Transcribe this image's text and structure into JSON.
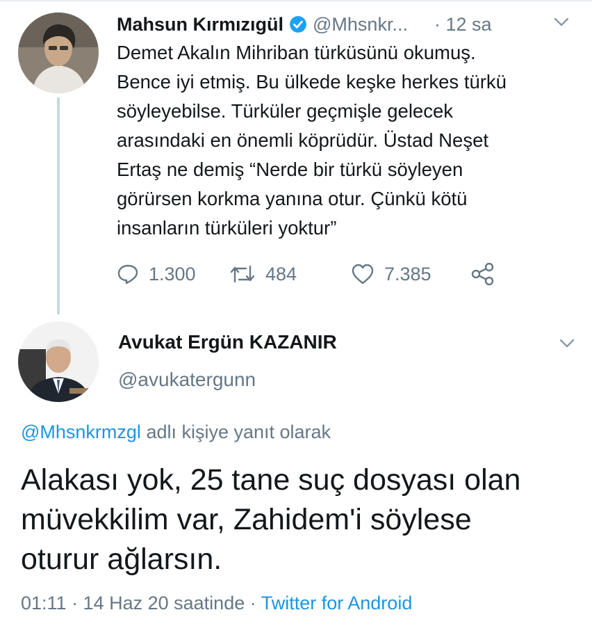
{
  "colors": {
    "text_primary": "#14171a",
    "text_secondary": "#657786",
    "link": "#1b95e0",
    "verified": "#1da1f2",
    "thread_line": "#ccd6dd"
  },
  "tweet": {
    "author_name": "Mahsun Kırmızıgül",
    "verified_icon": "verified-badge-icon",
    "handle": "@Mhsnkr...",
    "time": "· 12 sa",
    "text_lines": [
      "Demet Akalın Mihriban türküsünü okumuş.",
      "Bence iyi etmiş. Bu ülkede keşke herkes türkü",
      "söyleyebilse.  Türküler geçmişle gelecek",
      "arasındaki en önemli köprüdür. Üstad Neşet",
      "Ertaş ne demiş  “Nerde bir türkü söyleyen",
      "görürsen korkma yanına otur. Çünkü kötü",
      "insanların türküleri yoktur”"
    ],
    "replies": "1.300",
    "retweets": "484",
    "likes": "7.385",
    "icons": [
      "reply-icon",
      "retweet-icon",
      "like-icon",
      "share-icon"
    ]
  },
  "reply": {
    "author_name": "Avukat Ergün KAZANIR",
    "handle": "@avukatergunn",
    "reply_mention": "@Mhsnkrmzgl",
    "reply_context_suffix": " adlı kişiye yanıt olarak",
    "text_lines": [
      "Alakası yok, 25 tane suç dosyası olan",
      "müvekkilim var, Zahidem'i söylese",
      "oturur ağlarsın."
    ],
    "timestamp": "01:11 · 14 Haz 20 saatinde · ",
    "source": "Twitter for Android"
  }
}
